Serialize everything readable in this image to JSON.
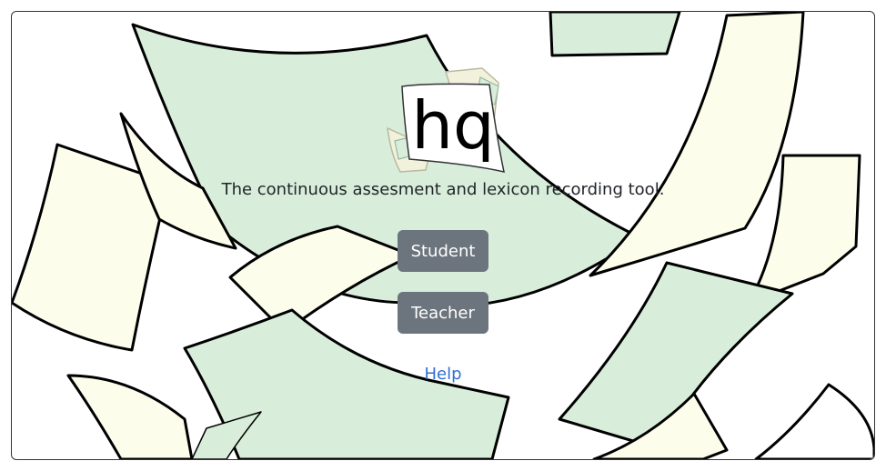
{
  "logo": {
    "text": "hq",
    "icon": "hq-paper-logo"
  },
  "tagline": "The continuous assesment and lexicon recording tool.",
  "buttons": {
    "student": "Student",
    "teacher": "Teacher"
  },
  "help_link": "Help",
  "colors": {
    "button_bg": "#6c757d",
    "link": "#2f6fd6",
    "paper_green": "#d8eedb",
    "paper_cream": "#fdfdec",
    "outline": "#000000"
  }
}
